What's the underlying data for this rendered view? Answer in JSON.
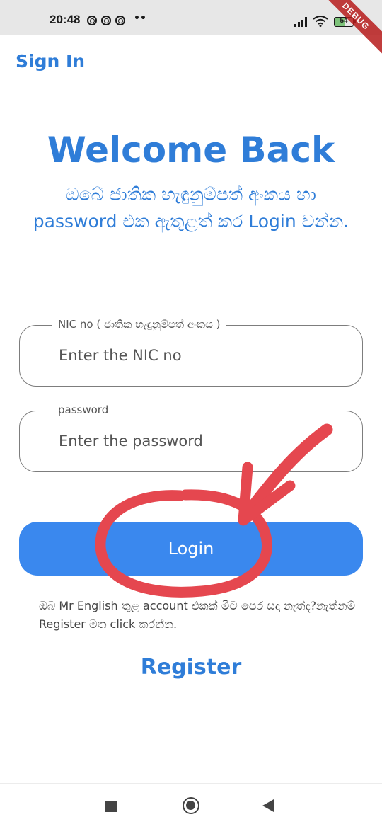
{
  "status_bar": {
    "time": "20:48",
    "dots": "••",
    "battery": "54",
    "debug_banner": "DEBUG",
    "icons": [
      "notification-circle-icon",
      "notification-circle-icon",
      "notification-circle-icon",
      "signal-icon",
      "wifi-icon",
      "battery-icon"
    ]
  },
  "app_bar": {
    "title": "Sign In"
  },
  "header": {
    "title": "Welcome Back",
    "subtitle": "ඔබේ ජාතික හැඳුනුම්පත් අංකය හා password එක ඇතුළත් කර Login වන්න."
  },
  "form": {
    "nic_field": {
      "label": "NIC no ( ජාතික හැඳුනුම්පත් අංකය )",
      "placeholder": "Enter the NIC no"
    },
    "password_field": {
      "label": "password",
      "placeholder": "Enter the password"
    },
    "login_label": "Login"
  },
  "footer": {
    "help_text": "ඔබ Mr English තුළ account එකක් මීට පෙර සදා නැත්ද?නැත්නම් Register මත click කරන්න.",
    "register_label": "Register"
  },
  "nav_bar": {
    "icons": [
      "recent-apps-icon",
      "home-icon",
      "back-icon"
    ]
  },
  "colors": {
    "accent": "#2f7dd8",
    "button": "#3a88ee",
    "annotation": "#e5474f"
  }
}
